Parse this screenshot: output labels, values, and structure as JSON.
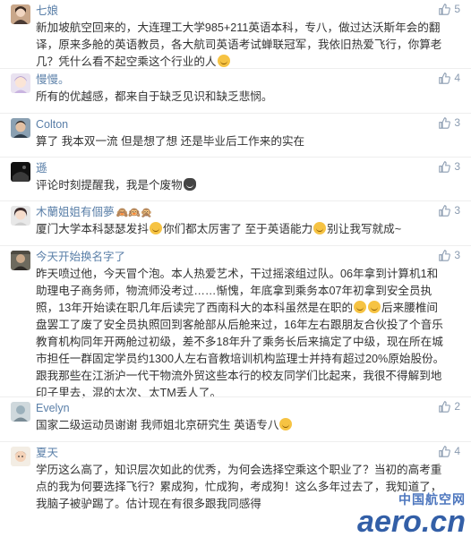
{
  "comments": [
    {
      "name": "七娘",
      "likes": "5",
      "text": "新加坡航空回来的，大连理工大学985+211英语本科，专八，做过达沃斯年会的翻译，原来多舱的英语教员，各大航司英语考试蝉联冠军，我依旧热爱飞行，你算老几？凭什么看不起空乘这个行业的人",
      "tail_emoji": "smile"
    },
    {
      "name": "慢慢。",
      "likes": "4",
      "text": "所有的优越感，都来自于缺乏见识和缺乏悲悯。"
    },
    {
      "name": "Colton",
      "likes": "3",
      "text": "算了 我本双一流 但是想了想 还是毕业后工作来的实在"
    },
    {
      "name": "遜",
      "likes": "3",
      "text": "评论时刻提醒我，我是个废物",
      "tail_emoji": "skull"
    },
    {
      "name": "木蘭姐姐有個夢",
      "name_suffix": "🙈🙉🙊",
      "likes": "3",
      "text_parts": [
        "厦门大学本科瑟瑟发抖",
        "你们都太厉害了 至于英语能力",
        "别让我写就成~"
      ]
    },
    {
      "name": "今天开始换名字了",
      "likes": "3",
      "text_parts": [
        "昨天喷过他，今天冒个泡。本人热爱艺术，干过摇滚组过队。06年拿到计算机1和助理电子商务师，物流师没考过……惭愧，年底拿到乘务本07年初拿到安全员执照，13年开始读在职几年后读完了西南科大的本科虽然是在职的",
        "",
        "后来腰椎间盘罢工了废了安全员执照回到客舱部从后舱来过，16年左右跟朋友合伙投了个音乐教育机构同年开两舱过初级，差不多18年升了乘务长后来搞定了中级，现在所在城市担任一群固定学员约1300人左右音教培训机构监理士并持有超过20%原始股份。跟我那些在江浙沪一代干物流外贸这些本行的校友同学们比起来，我很不得解到地印子里去，混的太次、太TM丢人了。"
      ]
    },
    {
      "name": "Evelyn",
      "likes": "2",
      "text": "国家二级运动员谢谢 我师姐北京研究生 英语专八",
      "tail_emoji": "smile"
    },
    {
      "name": "夏天",
      "likes": "4",
      "text": "学历这么高了，知识层次如此的优秀，为何会选择空乘这个职业了？当初的高考重点的我为何要选择飞行？累成狗，忙成狗，考成狗！这么多年过去了，我知道了，我脑子被驴踢了。估计现在有很多跟我同感得"
    }
  ],
  "watermark": {
    "cn": "中国航空网",
    "en": "aero.cn"
  }
}
